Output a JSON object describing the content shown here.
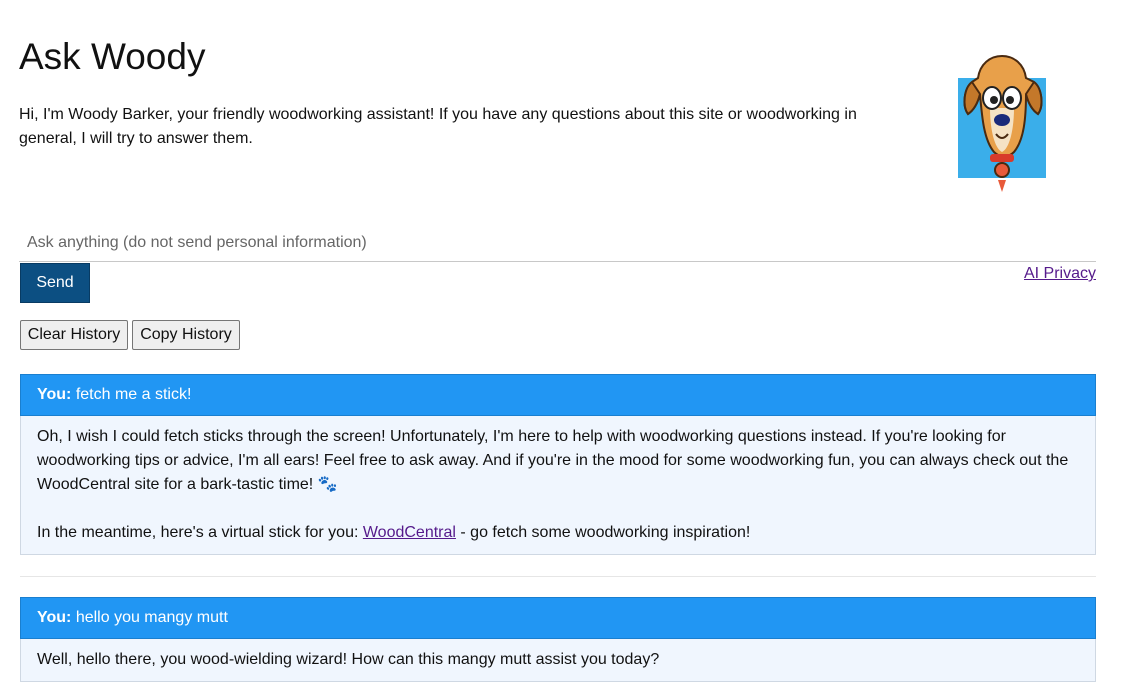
{
  "header": {
    "title": "Ask Woody",
    "intro": "Hi, I'm Woody Barker, your friendly woodworking assistant! If you have any questions about this site or woodworking in general, I will try to answer them."
  },
  "composer": {
    "placeholder": "Ask anything (do not send personal information)",
    "send_label": "Send",
    "privacy_label": "AI Privacy"
  },
  "history_buttons": {
    "clear_label": "Clear History",
    "copy_label": "Copy History"
  },
  "chat": [
    {
      "user_prefix": "You:",
      "user_text": "fetch me a stick!",
      "reply_p1": "Oh, I wish I could fetch sticks through the screen! Unfortunately, I'm here to help with woodworking questions instead. If you're looking for woodworking tips or advice, I'm all ears! Feel free to ask away. And if you're in the mood for some woodworking fun, you can always check out the WoodCentral site for a bark-tastic time! 🐾",
      "reply_p2_before": "In the meantime, here's a virtual stick for you: ",
      "reply_link": "WoodCentral",
      "reply_p2_after": " - go fetch some woodworking inspiration!"
    },
    {
      "user_prefix": "You:",
      "user_text": "hello you mangy mutt",
      "reply_p1": "Well, hello there, you wood-wielding wizard! How can this mangy mutt assist you today?"
    }
  ],
  "colors": {
    "user_bar": "#2196f3",
    "send_button": "#0c4f82",
    "reply_bg": "#f0f6fe",
    "link": "#551a8b"
  },
  "icons": {
    "mascot": "dog-mascot-icon"
  }
}
